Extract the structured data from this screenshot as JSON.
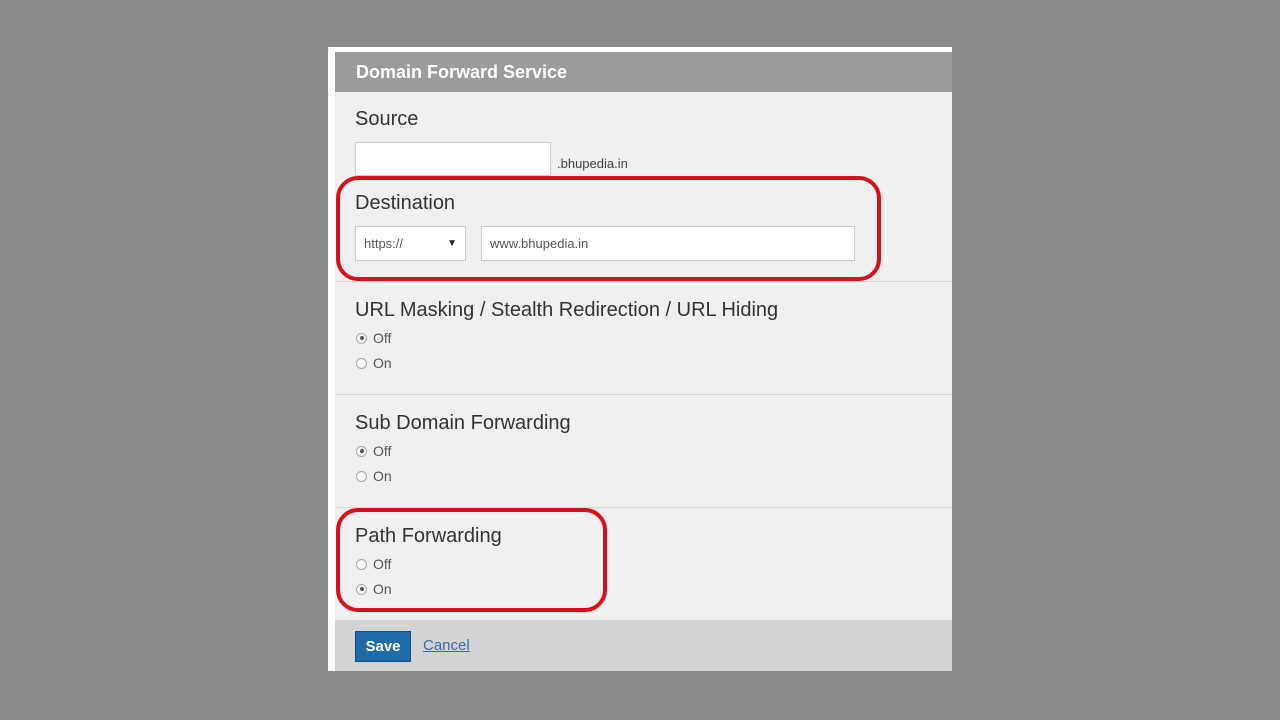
{
  "dialog": {
    "title": "Domain Forward Service"
  },
  "source": {
    "label": "Source",
    "value": "",
    "suffix": ".bhupedia.in"
  },
  "destination": {
    "label": "Destination",
    "protocol": "https://",
    "dropdown_icon": "▼",
    "url": "www.bhupedia.in"
  },
  "url_masking": {
    "label": "URL Masking / Stealth Redirection / URL Hiding",
    "options": [
      {
        "label": "Off",
        "selected": true
      },
      {
        "label": "On",
        "selected": false
      }
    ]
  },
  "sub_domain": {
    "label": "Sub Domain Forwarding",
    "options": [
      {
        "label": "Off",
        "selected": true
      },
      {
        "label": "On",
        "selected": false
      }
    ]
  },
  "path_forwarding": {
    "label": "Path Forwarding",
    "options": [
      {
        "label": "Off",
        "selected": false
      },
      {
        "label": "On",
        "selected": true
      }
    ]
  },
  "footer": {
    "save_label": "Save",
    "cancel_label": "Cancel"
  },
  "colors": {
    "highlight": "#d8101a",
    "save_button": "#1f6aa8",
    "header": "#9b9b9b"
  }
}
